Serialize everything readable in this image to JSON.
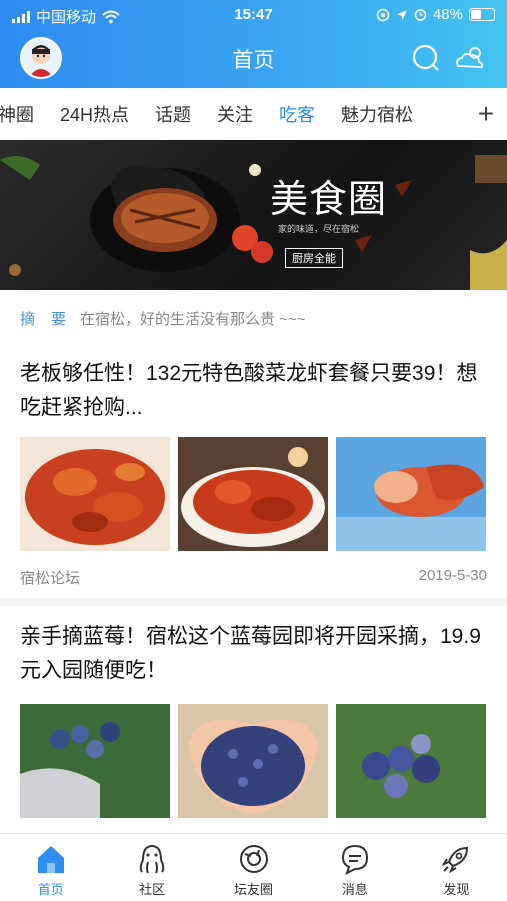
{
  "status_bar": {
    "carrier": "中国移动",
    "time": "15:47",
    "battery": "48%"
  },
  "header": {
    "title": "首页"
  },
  "tabs": {
    "items": [
      "神圈",
      "24H热点",
      "话题",
      "关注",
      "吃客",
      "魅力宿松"
    ],
    "active_index": 4,
    "add_label": "+"
  },
  "banner": {
    "title": "美食圈",
    "subtitle": "家的味道，尽在宿松",
    "tag": "厨房全能"
  },
  "summary": {
    "label": "摘 要",
    "text": "在宿松，好的生活没有那么贵 ~~~"
  },
  "articles": [
    {
      "title": "老板够任性！132元特色酸菜龙虾套餐只要39！想吃赶紧抢购...",
      "source": "宿松论坛",
      "date": "2019-5-30"
    },
    {
      "title": "亲手摘蓝莓！宿松这个蓝莓园即将开园采摘，19.9元入园随便吃！",
      "source": "",
      "date": ""
    }
  ],
  "bottom_nav": {
    "items": [
      "首页",
      "社区",
      "坛友圈",
      "消息",
      "发现"
    ],
    "active_index": 0
  },
  "colors": {
    "accent": "#2f8cf0",
    "header_start": "#2f8cf0",
    "header_end": "#44c3f0",
    "muted": "#888888"
  }
}
